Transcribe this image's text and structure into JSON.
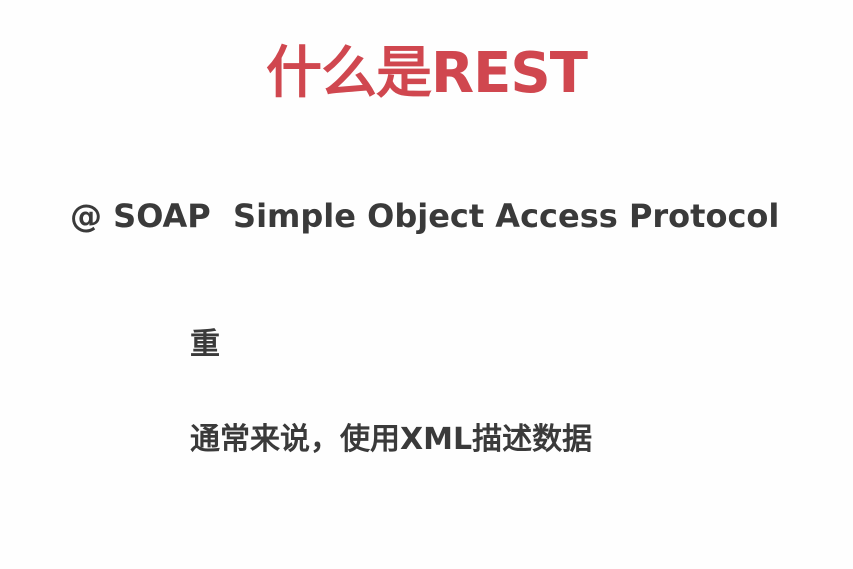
{
  "slide": {
    "title": "什么是REST",
    "subtitle": "@ SOAP  Simple Object Access Protocol",
    "points": [
      "重",
      "通常来说，使用XML描述数据"
    ]
  },
  "colors": {
    "title": "#d0474f",
    "body_text": "#3a3a3a",
    "background": "#fefefe"
  }
}
